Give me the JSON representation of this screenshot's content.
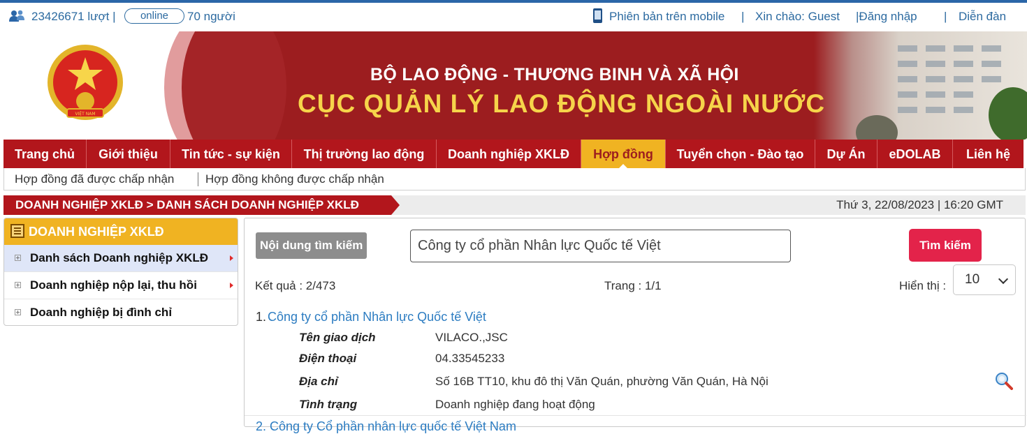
{
  "topbar": {
    "visits": "23426671 lượt |",
    "online_label": "online",
    "online_count": "70 người",
    "mobile_link": "Phiên bản trên mobile",
    "sep1": "|",
    "greeting": "Xin chào: Guest",
    "login": "|Đăng nhập",
    "sep2": "|",
    "forum": "Diễn đàn"
  },
  "banner": {
    "ministry": "BỘ LAO ĐỘNG - THƯƠNG BINH VÀ XÃ HỘI",
    "agency": "CỤC QUẢN LÝ LAO ĐỘNG NGOÀI NƯỚC",
    "emblem_text": "VIỆT NAM"
  },
  "nav": {
    "items": [
      {
        "label": "Trang chủ"
      },
      {
        "label": "Giới thiệu"
      },
      {
        "label": "Tin tức - sự kiện"
      },
      {
        "label": "Thị trường lao động"
      },
      {
        "label": "Doanh nghiệp XKLĐ"
      },
      {
        "label": "Hợp đồng",
        "active": true
      },
      {
        "label": "Tuyển chọn - Đào tạo"
      },
      {
        "label": "Dự Án"
      },
      {
        "label": "eDOLAB"
      },
      {
        "label": "Liên hệ"
      }
    ]
  },
  "subnav": {
    "items": [
      {
        "label": "Hợp đồng đã được chấp nhận"
      },
      {
        "label": "Hợp đồng không được chấp nhận"
      }
    ]
  },
  "breadcrumb": {
    "text": "DOANH NGHIỆP XKLĐ > DANH SÁCH DOANH NGHIỆP XKLĐ",
    "datetime": "Thứ 3, 22/08/2023 | 16:20 GMT"
  },
  "sidebar": {
    "title": "DOANH NGHIỆP XKLĐ",
    "items": [
      {
        "label": "Danh sách Doanh nghiệp XKLĐ",
        "active": true
      },
      {
        "label": "Doanh nghiệp nộp lại, thu hồi"
      },
      {
        "label": "Doanh nghiệp bị đình chỉ"
      }
    ]
  },
  "search": {
    "label": "Nội dung tìm kiếm",
    "value": "Công ty cổ phần Nhân lực Quốc tế Việt",
    "button": "Tìm kiếm"
  },
  "results": {
    "count": "Kết quả : 2/473",
    "page": "Trang : 1/1",
    "show_label": "Hiển thị :",
    "page_size": "10"
  },
  "items": [
    {
      "num": "1.",
      "name": "Công ty cổ phần Nhân lực Quốc tế Việt",
      "fields": [
        {
          "label": "Tên giao dịch",
          "value": "VILACO.,JSC"
        },
        {
          "label": "Điện thoại",
          "value": "04.33545233"
        },
        {
          "label": "Địa chỉ",
          "value": "Số 16B TT10, khu đô thị Văn Quán, phường Văn Quán, Hà Nội"
        },
        {
          "label": "Tình trạng",
          "value": "Doanh nghiệp đang hoạt động"
        }
      ]
    }
  ],
  "next_item_peek": "2. Công ty Cổ phần nhân lực quốc tế Việt Nam",
  "colors": {
    "primary_red": "#b2161c",
    "accent_yellow": "#f0b322",
    "link_blue": "#2c7cc1",
    "button_pink": "#e3234a"
  }
}
